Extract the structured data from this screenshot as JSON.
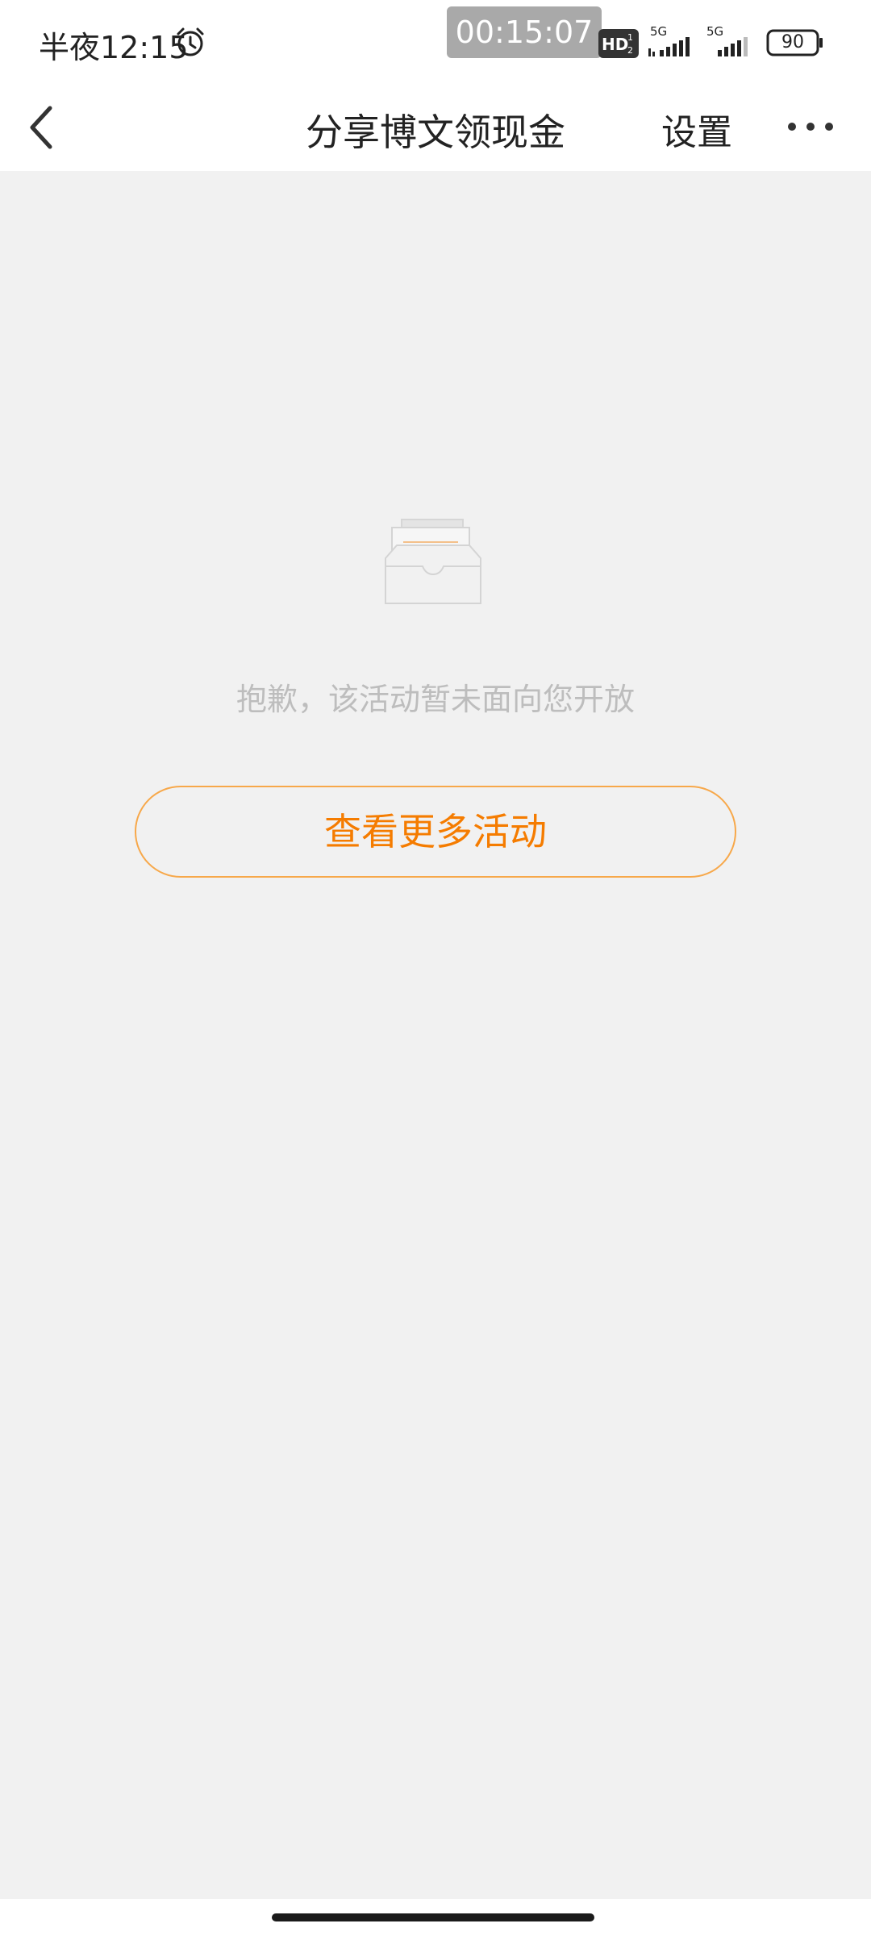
{
  "status_bar": {
    "time": "半夜12:15",
    "recording_timer": "00:15:07",
    "battery": "90",
    "signal1_label": "5G",
    "signal2_label": "5G",
    "icons": [
      "alarm-icon",
      "hd-icon",
      "signal-5g-icon",
      "signal-5g-icon",
      "battery-icon"
    ]
  },
  "nav": {
    "title": "分享博文领现金",
    "settings_label": "设置",
    "back_icon": "chevron-left-icon",
    "more_icon": "more-dots-icon"
  },
  "empty_state": {
    "illustration": "empty-inbox-icon",
    "message": "抱歉，该活动暂未面向您开放",
    "button_label": "查看更多活动"
  },
  "colors": {
    "background": "#f1f1f1",
    "accent": "#f57c00",
    "accent_border": "#f7a84a",
    "muted_text": "#bdbdbd"
  }
}
